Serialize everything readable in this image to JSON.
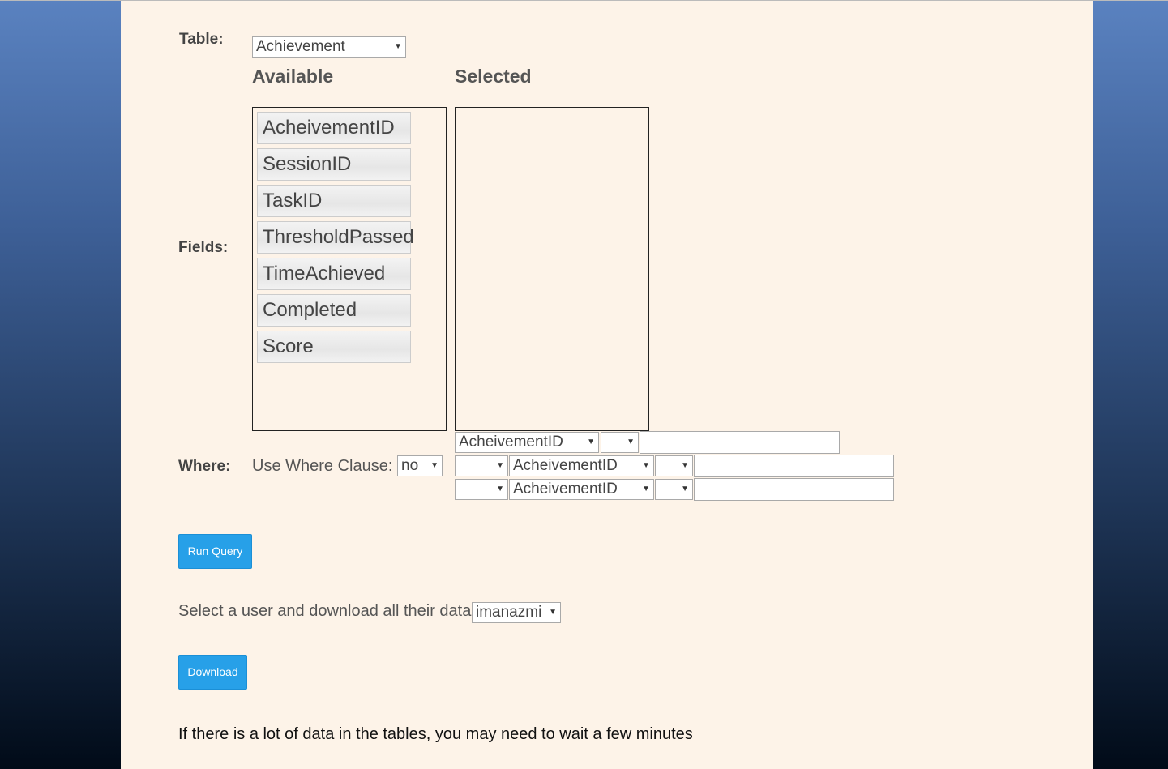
{
  "table": {
    "label": "Table:",
    "selected": "Achievement"
  },
  "fields": {
    "label": "Fields:",
    "available_heading": "Available",
    "selected_heading": "Selected",
    "available_items": [
      "AcheivementID",
      "SessionID",
      "TaskID",
      "ThresholdPassed",
      "TimeAchieved",
      "Completed",
      "Score"
    ],
    "selected_items": []
  },
  "where": {
    "label": "Where:",
    "use_clause_label": "Use Where Clause:",
    "use_clause_value": "no",
    "rows": [
      {
        "connector": "",
        "field": "AcheivementID",
        "operator": "",
        "value": ""
      },
      {
        "connector": "",
        "field": "AcheivementID",
        "operator": "",
        "value": ""
      },
      {
        "connector": "",
        "field": "AcheivementID",
        "operator": "",
        "value": ""
      }
    ]
  },
  "run_query_label": "Run Query",
  "download_section": {
    "prompt": "Select a user and download all their data",
    "user_selected": "imanazmi",
    "button_label": "Download"
  },
  "note": "If there is a lot of data in the tables, you may need to wait a few minutes",
  "icons": {
    "dropdown": "dropdown-caret-icon"
  }
}
